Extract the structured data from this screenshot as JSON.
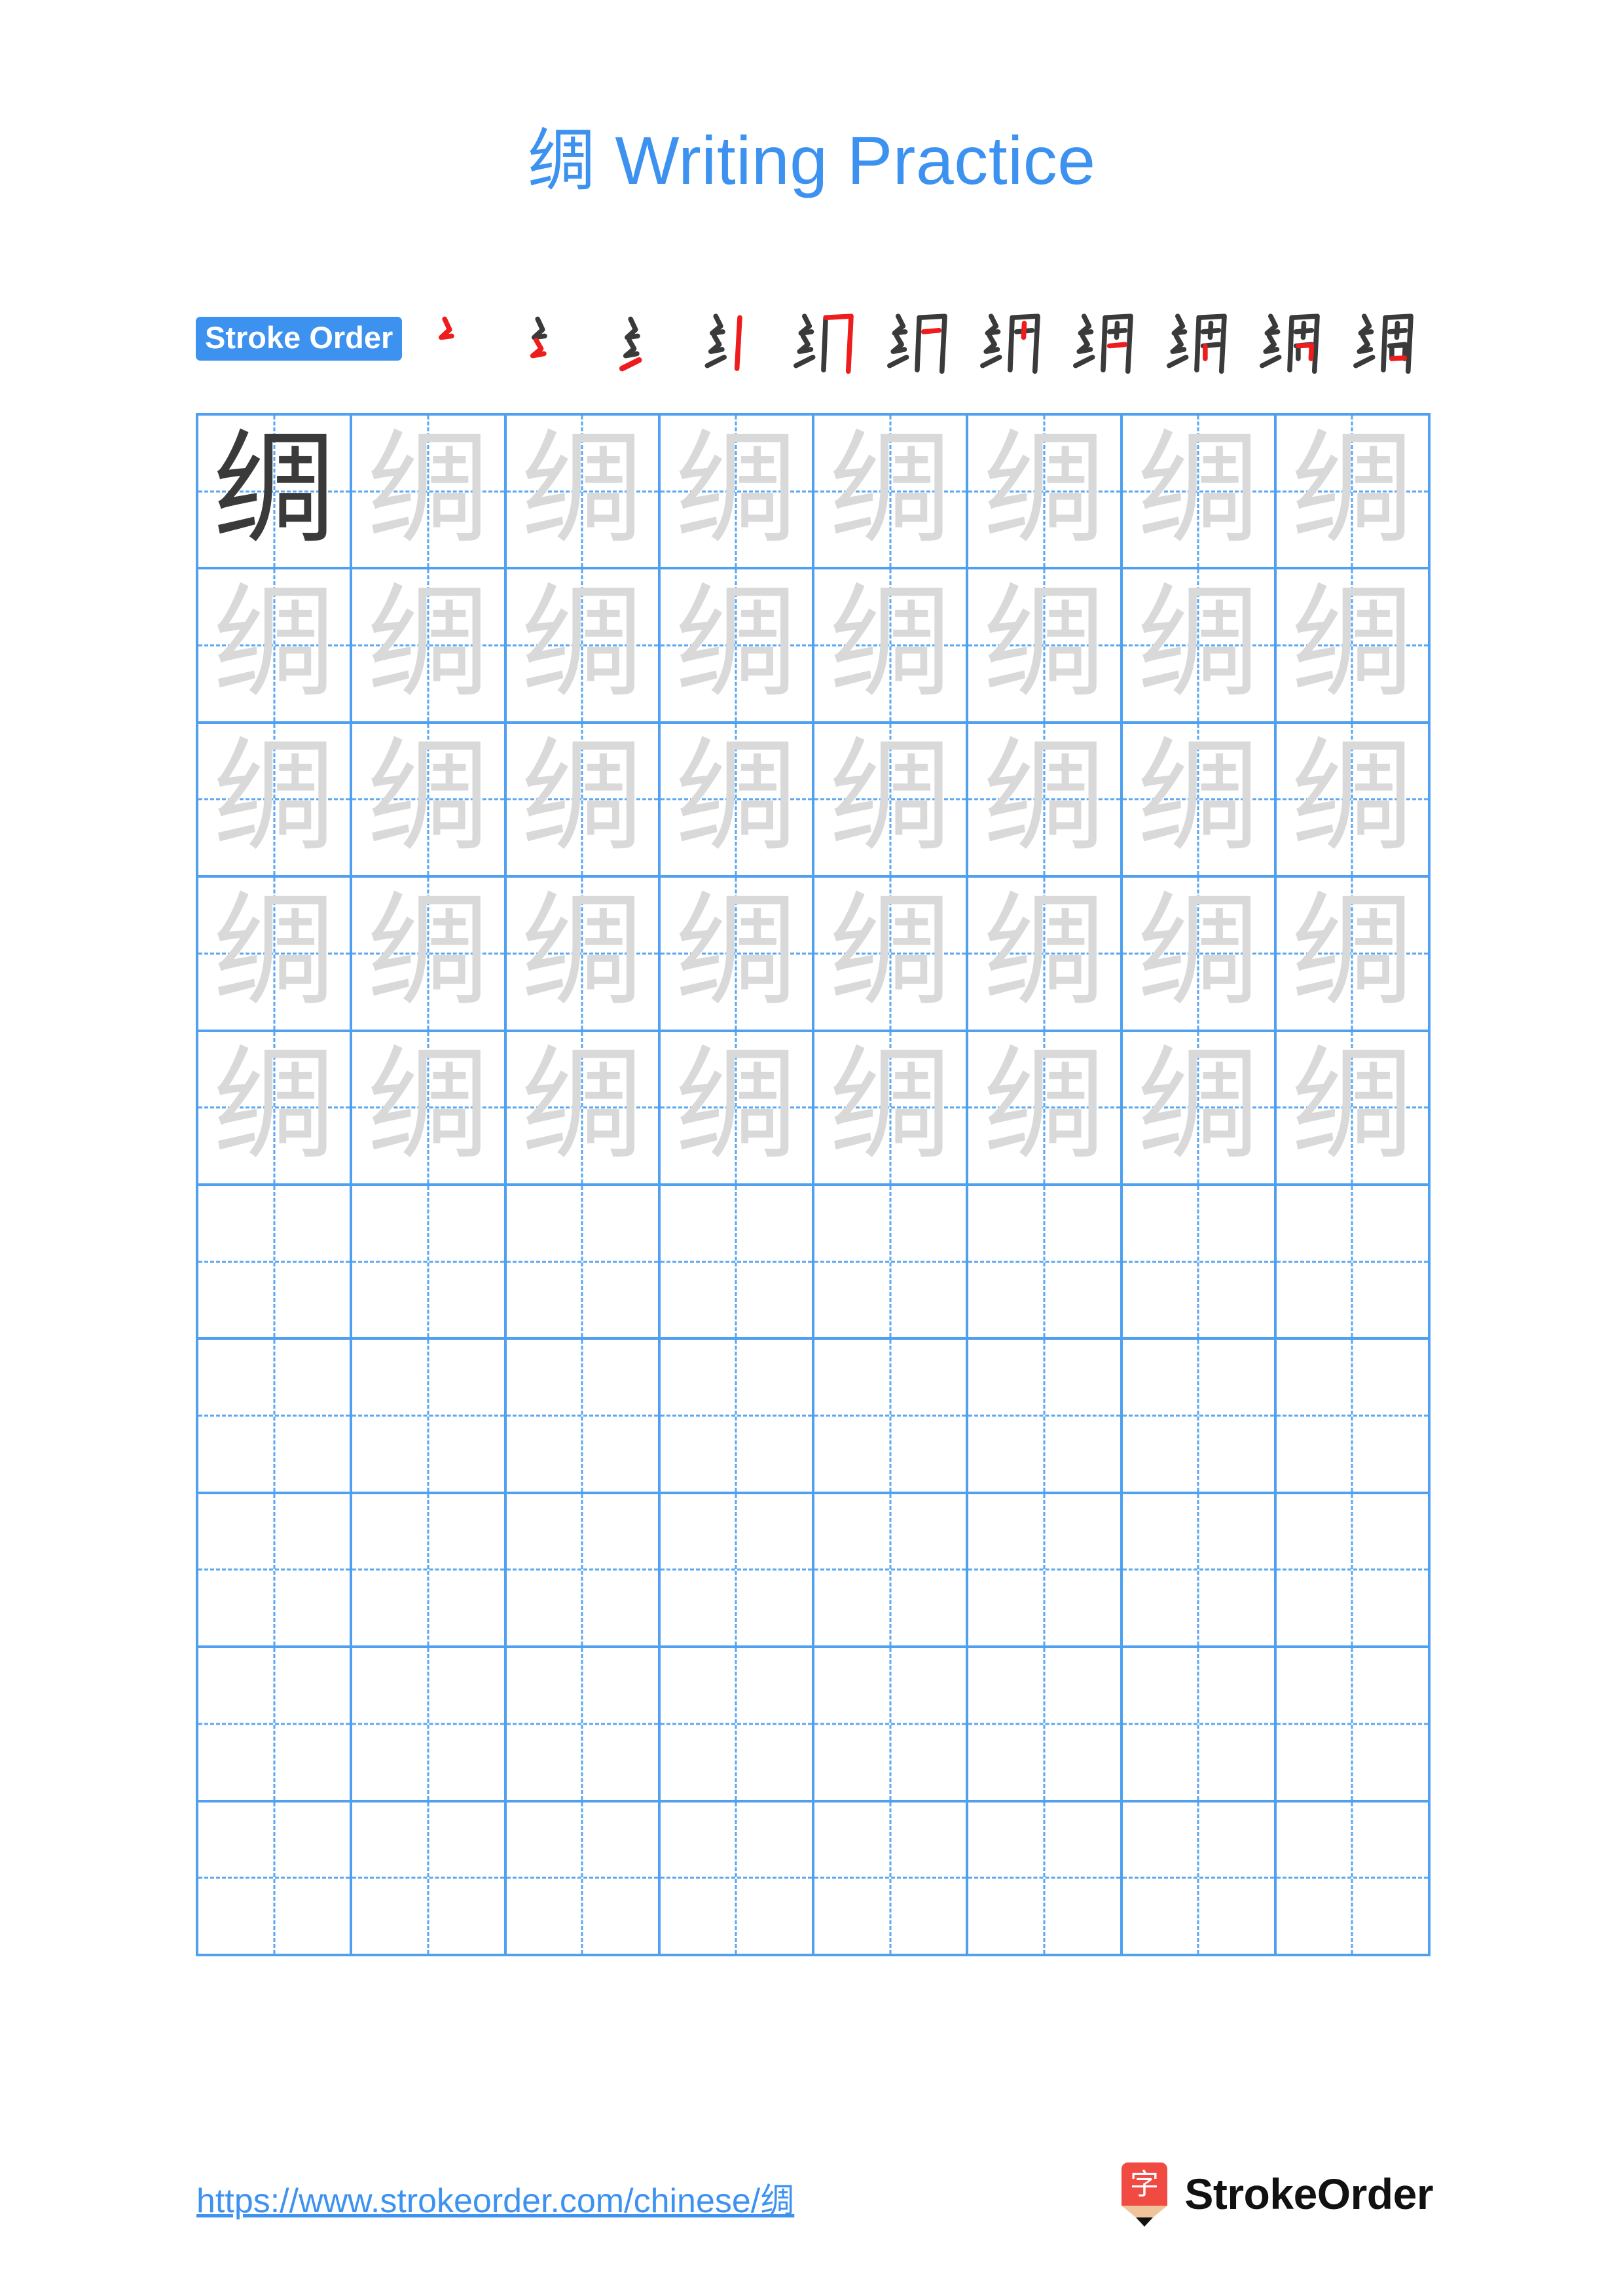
{
  "document": {
    "character": "绸",
    "title_suffix": " Writing Practice",
    "title_full": "绸 Writing Practice"
  },
  "stroke_order": {
    "label": "Stroke Order",
    "step_count": 11,
    "steps": [
      {
        "index": 1,
        "new_stroke": "㇇ (héng piě / starting curve)",
        "partial": "㇜"
      },
      {
        "index": 2,
        "new_stroke": "㇜ (second curve)",
        "partial": "ㄥ"
      },
      {
        "index": 3,
        "new_stroke": "㇀ (rising tick)",
        "partial": "纟"
      },
      {
        "index": 4,
        "new_stroke": "丨 (vertical of 冂)",
        "partial": "纟丿"
      },
      {
        "index": 5,
        "new_stroke": "㇆ (horizontal-bend-hook)",
        "partial": "纠"
      },
      {
        "index": 6,
        "new_stroke": "一 (horizontal inside)",
        "partial": "纲"
      },
      {
        "index": 7,
        "new_stroke": "丨 (short vertical inside)",
        "partial": "纲"
      },
      {
        "index": 8,
        "new_stroke": "一 (horizontal)",
        "partial": "绸"
      },
      {
        "index": 9,
        "new_stroke": "丨 (vertical of 口)",
        "partial": "绸"
      },
      {
        "index": 10,
        "new_stroke": "㇕ (horizontal-fold)",
        "partial": "绸"
      },
      {
        "index": 11,
        "new_stroke": "一 (final horizontal)",
        "partial": "绸"
      }
    ]
  },
  "practice_grid": {
    "columns": 8,
    "rows": 10,
    "filled_rows": 5,
    "first_cell_style": "dark",
    "trace_cell_style": "light-gray",
    "guide_lines": "dashed-cross",
    "cells": [
      [
        "绸",
        "绸",
        "绸",
        "绸",
        "绸",
        "绸",
        "绸",
        "绸"
      ],
      [
        "绸",
        "绸",
        "绸",
        "绸",
        "绸",
        "绸",
        "绸",
        "绸"
      ],
      [
        "绸",
        "绸",
        "绸",
        "绸",
        "绸",
        "绸",
        "绸",
        "绸"
      ],
      [
        "绸",
        "绸",
        "绸",
        "绸",
        "绸",
        "绸",
        "绸",
        "绸"
      ],
      [
        "绸",
        "绸",
        "绸",
        "绸",
        "绸",
        "绸",
        "绸",
        "绸"
      ],
      [
        "",
        "",
        "",
        "",
        "",
        "",
        "",
        ""
      ],
      [
        "",
        "",
        "",
        "",
        "",
        "",
        "",
        ""
      ],
      [
        "",
        "",
        "",
        "",
        "",
        "",
        "",
        ""
      ],
      [
        "",
        "",
        "",
        "",
        "",
        "",
        "",
        ""
      ],
      [
        "",
        "",
        "",
        "",
        "",
        "",
        "",
        ""
      ]
    ]
  },
  "footer": {
    "url": "https://www.strokeorder.com/chinese/绸",
    "brand_name": "StrokeOrder",
    "brand_mark_char": "字"
  },
  "colors": {
    "accent_blue": "#3d92f0",
    "grid_blue": "#4fa0f0",
    "guide_blue": "#5aa7f2",
    "stroke_dark": "#3a3a3a",
    "stroke_new_red": "#ee1c1c",
    "trace_gray": "#d9d9d9",
    "brand_red": "#f04a43",
    "brand_wood": "#f0c49b",
    "brand_text": "#111111"
  }
}
